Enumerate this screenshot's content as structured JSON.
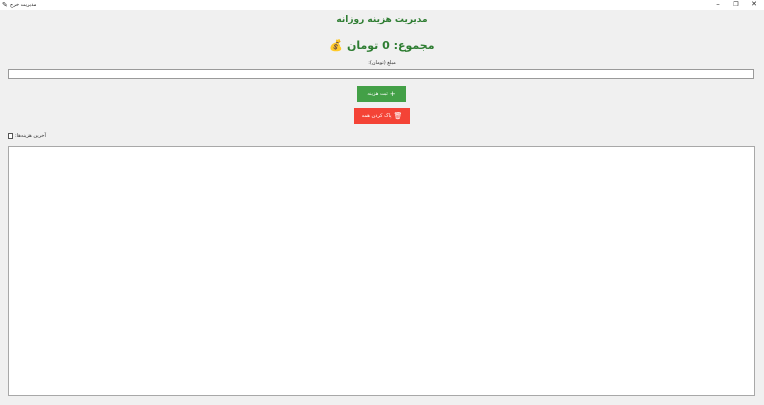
{
  "window": {
    "title": "مدیریت خرج",
    "icon": "money-bag-icon",
    "controls": {
      "minimize": "–",
      "maximize": "❐",
      "close": "✕"
    }
  },
  "header": {
    "title": "مدیریت هزینه روزانه",
    "total": "مجموع: 0 تومان 💰"
  },
  "form": {
    "amount_label": "مبلغ (تومان):",
    "amount_value": ""
  },
  "buttons": {
    "add_label": "ثبت هزینه",
    "add_icon": "+",
    "clear_label": "پاک کردن همه",
    "clear_icon": "🗑"
  },
  "list": {
    "label": "آخرین هزینه‌ها:"
  },
  "colors": {
    "title_green": "#2e7d32",
    "add_button": "#43a047",
    "clear_button": "#f44336",
    "background": "#f0f0f0"
  }
}
